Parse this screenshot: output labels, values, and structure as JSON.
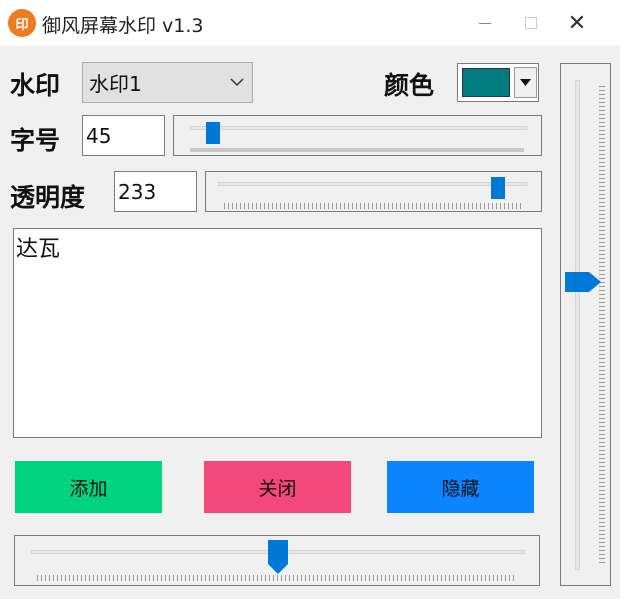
{
  "window": {
    "title": "御风屏幕水印 v1.3",
    "app_icon_text": "印",
    "controls": [
      "minimize",
      "maximize",
      "close"
    ]
  },
  "watermark": {
    "label": "水印",
    "selected": "水印1"
  },
  "color": {
    "label": "颜色",
    "value": "#007B80"
  },
  "font_size": {
    "label": "字号",
    "value": "45",
    "slider_fraction": 0.05
  },
  "opacity": {
    "label": "透明度",
    "value": "233",
    "slider_fraction": 0.91
  },
  "text_area": {
    "content": "达瓦"
  },
  "buttons": {
    "add": {
      "label": "添加",
      "color": "#00d47e"
    },
    "close": {
      "label": "关闭",
      "color": "#f5487a"
    },
    "hide": {
      "label": "隐藏",
      "color": "#0a84ff"
    }
  },
  "horizontal_position": {
    "slider_fraction": 0.49
  },
  "vertical_position": {
    "slider_fraction": 0.4
  }
}
